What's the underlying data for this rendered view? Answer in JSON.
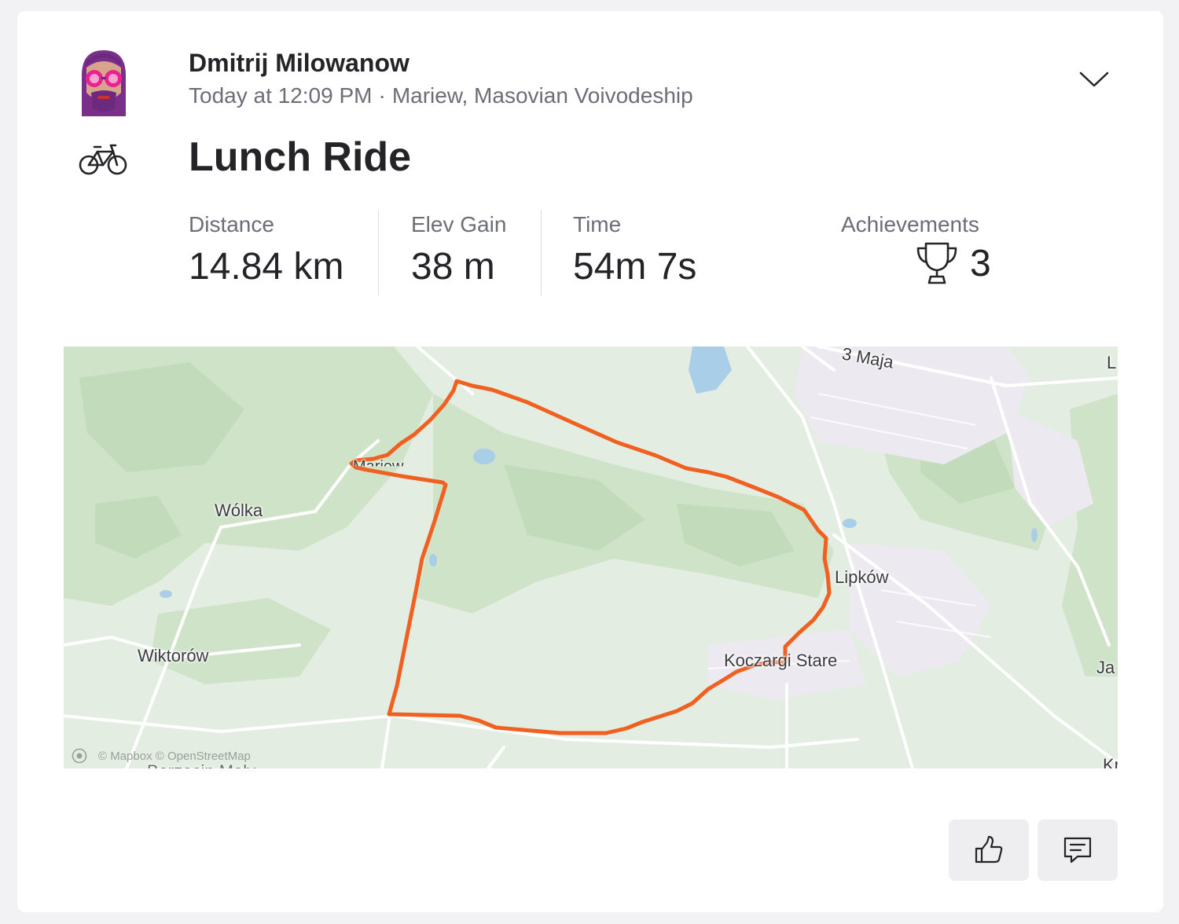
{
  "athlete": {
    "name": "Dmitrij Milowanow",
    "time": "Today at 12:09 PM",
    "separator": "·",
    "location": "Mariew, Masovian Voivodeship"
  },
  "activity": {
    "sport_icon": "bike-icon",
    "title": "Lunch Ride"
  },
  "stats": [
    {
      "label": "Distance",
      "value": "14.84 km"
    },
    {
      "label": "Elev Gain",
      "value": "38 m"
    },
    {
      "label": "Time",
      "value": "54m 7s"
    }
  ],
  "achievements": {
    "label": "Achievements",
    "icon": "trophy-icon",
    "count": "3"
  },
  "map": {
    "route_color": "#f06020",
    "places": [
      "3 Maja",
      "L",
      "Mariew",
      "Wólka",
      "Lipków",
      "Wiktorów",
      "Koczargi Stare",
      "Ja",
      "Kr",
      "Borzęcin Mały"
    ],
    "attribution": "© Mapbox © OpenStreetMap"
  },
  "actions": {
    "kudos_icon": "thumbs-up-icon",
    "comment_icon": "comment-icon"
  },
  "colors": {
    "text_primary": "#242428",
    "text_secondary": "#6d6d78",
    "button_bg": "#eeeef1"
  }
}
